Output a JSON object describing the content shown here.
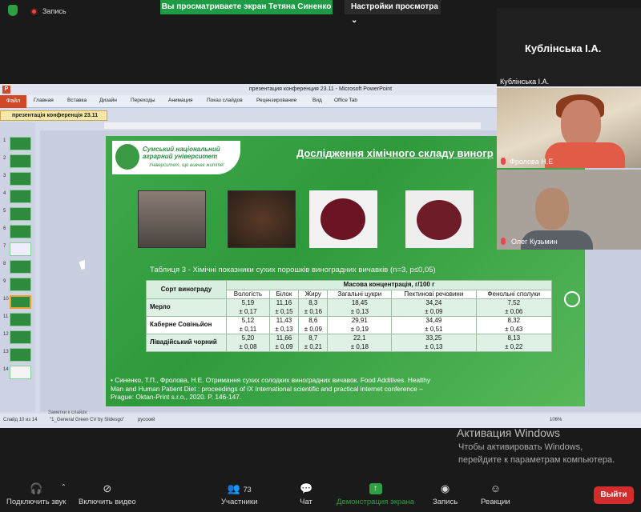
{
  "zoom": {
    "record_label": "Запись",
    "share_banner": "Вы просматриваете экран Тетяна Синенко",
    "view_options": "Настройки просмотра",
    "toolbar": {
      "audio": "Подключить звук",
      "video": "Включить видео",
      "participants": "Участники",
      "participants_count": "73",
      "chat": "Чат",
      "share": "Демонстрация экрана",
      "record": "Запись",
      "reactions": "Реакции",
      "leave": "Выйти"
    },
    "tiles": [
      {
        "name_big": "Кублінська І.А.",
        "label": "Кублінська І.А."
      },
      {
        "label": "Фролова Н.Е"
      },
      {
        "label": "Олег Кузьмин"
      }
    ]
  },
  "powerpoint": {
    "window_title": "презентация конференция 23.11  -  Microsoft PowerPoint",
    "tabs": [
      "Файл",
      "Главная",
      "Вставка",
      "Дизайн",
      "Переходы",
      "Анимация",
      "Показ слайдов",
      "Рецензирование",
      "Вид",
      "Office Tab"
    ],
    "doc_tab": "презентація конференція 23.11",
    "thumbnail_numbers": [
      "1",
      "2",
      "3",
      "4",
      "5",
      "6",
      "7",
      "8",
      "9",
      "10",
      "11",
      "12",
      "13",
      "14"
    ],
    "status": {
      "slide": "Слайд 10 из 14",
      "theme": "\"1_General Green CV by Slidesgo\"",
      "lang": "русский",
      "zoom": "106%",
      "notes": "Заметки к слайду"
    }
  },
  "slide": {
    "university_name": "Сумський національний аграрний університет",
    "university_slogan": "Університет, що вивчає життя!",
    "title": "Дослідження хімічного складу виногр",
    "table_caption": "Таблиця 3 - Хімічні показники сухих порошків виноградних вичавків (n=3, p≤0,05)",
    "table": {
      "row_header": "Сорт винограду",
      "group_header": "Масова концентрація, г/100 г",
      "columns": [
        "Вологість",
        "Білок",
        "Жиру",
        "Загальні цукри",
        "Пектинові речовини",
        "Фенольні сполуки"
      ],
      "rows": [
        {
          "name": "Мерло",
          "values": [
            "5,19",
            "11,16",
            "8,3",
            "18,45",
            "34,24",
            "7,52"
          ],
          "errors": [
            "± 0,17",
            "± 0,15",
            "± 0,16",
            "± 0,13",
            "± 0,09",
            "± 0,06"
          ]
        },
        {
          "name": "Каберне Совіньйон",
          "values": [
            "5,12",
            "11,43",
            "8,6",
            "29,91",
            "34,49",
            "8,32"
          ],
          "errors": [
            "± 0,11",
            "± 0,13",
            "± 0,09",
            "± 0,19",
            "± 0,51",
            "± 0,43"
          ]
        },
        {
          "name": "Лівадійський чорний",
          "values": [
            "5,20",
            "11,66",
            "8,7",
            "22,1",
            "33,25",
            "8,13"
          ],
          "errors": [
            "± 0,08",
            "± 0,09",
            "± 0,21",
            "± 0,18",
            "± 0,13",
            "± 0,22"
          ]
        }
      ]
    },
    "reference": "Синенко, Т.П., Фролова, Н.Е. Отримання сухих солодких виноградних вичавок. Food Additives. Healthy Man and Human Patient Diet : proceedings of IX International scientific and practical internet conference – Prague: Oktan-Print s.r.o., 2020. P. 146-147."
  },
  "windows_activation": {
    "title": "Активация Windows",
    "line1": "Чтобы активировать Windows,",
    "line2": "перейдите к параметрам компьютера."
  }
}
